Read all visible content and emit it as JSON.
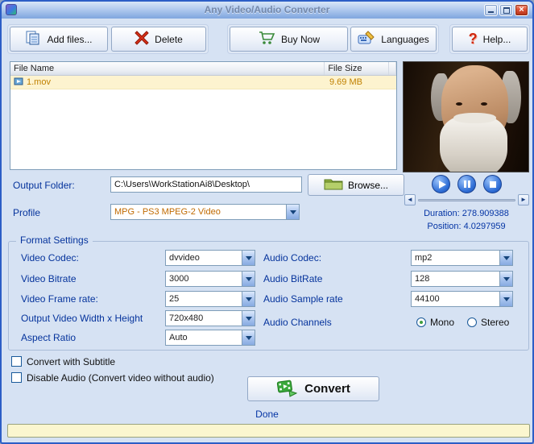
{
  "window": {
    "title": "Any Video/Audio Converter"
  },
  "toolbar": {
    "add_files_label": "Add files...",
    "delete_label": "Delete",
    "buy_now_label": "Buy Now",
    "languages_label": "Languages",
    "help_label": "Help..."
  },
  "file_list": {
    "columns": [
      "File Name",
      "File Size"
    ],
    "rows": [
      {
        "name": "1.mov",
        "size": "9.69 MB"
      }
    ]
  },
  "playback": {
    "duration": "Duration: 278.909388",
    "position": "Position: 4.0297959"
  },
  "output_folder": {
    "label": "Output Folder:",
    "value": "C:\\Users\\WorkStationAi8\\Desktop\\",
    "browse_label": "Browse..."
  },
  "profile": {
    "label": "Profile",
    "value": "MPG - PS3 MPEG-2 Video"
  },
  "format_settings": {
    "title": "Format Settings",
    "video_codec": {
      "label": "Video Codec:",
      "value": "dvvideo"
    },
    "video_bitrate": {
      "label": "Video Bitrate",
      "value": "3000"
    },
    "video_frame_rate": {
      "label": "Video Frame rate:",
      "value": "25"
    },
    "output_size": {
      "label": "Output Video Width x Height",
      "value": "720x480"
    },
    "aspect_ratio": {
      "label": "Aspect Ratio",
      "value": "Auto"
    },
    "audio_codec": {
      "label": "Audio Codec:",
      "value": "mp2"
    },
    "audio_bitrate": {
      "label": "Audio BitRate",
      "value": "128"
    },
    "audio_sample_rate": {
      "label": "Audio Sample rate",
      "value": "44100"
    },
    "audio_channels": {
      "label": "Audio Channels",
      "options": [
        "Mono",
        "Stereo"
      ],
      "selected": "Mono"
    }
  },
  "options": {
    "convert_with_subtitle": "Convert with Subtitle",
    "disable_audio": "Disable Audio (Convert video without audio)"
  },
  "convert_button_label": "Convert",
  "status_text": "Done",
  "colors": {
    "label_blue": "#05339c",
    "accent_orange": "#c08000",
    "row_highlight": "#fdf3cf",
    "titlebar_blue": "#9cbbe8",
    "progress_bg": "#fbf6cf"
  }
}
